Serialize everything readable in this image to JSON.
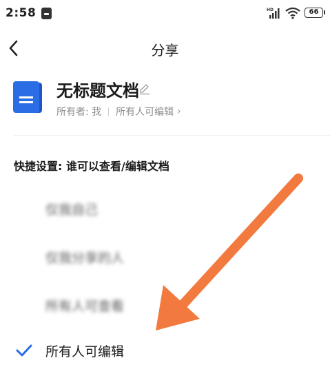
{
  "status_bar": {
    "time": "2:58",
    "battery": "66"
  },
  "nav": {
    "title": "分享"
  },
  "document": {
    "title": "无标题文档",
    "owner": "所有者: 我",
    "permission": "所有人可编辑"
  },
  "quick_settings": {
    "title": "快捷设置: 谁可以查看/编辑文档",
    "options": [
      {
        "label": "仅我自己",
        "selected": false
      },
      {
        "label": "仅我分享的人",
        "selected": false
      },
      {
        "label": "所有人可查看",
        "selected": false
      },
      {
        "label": "所有人可编辑",
        "selected": true
      }
    ]
  },
  "colors": {
    "accent": "#2b6de5",
    "arrow": "#f27a3e",
    "doc_icon": "#2b6de5"
  }
}
